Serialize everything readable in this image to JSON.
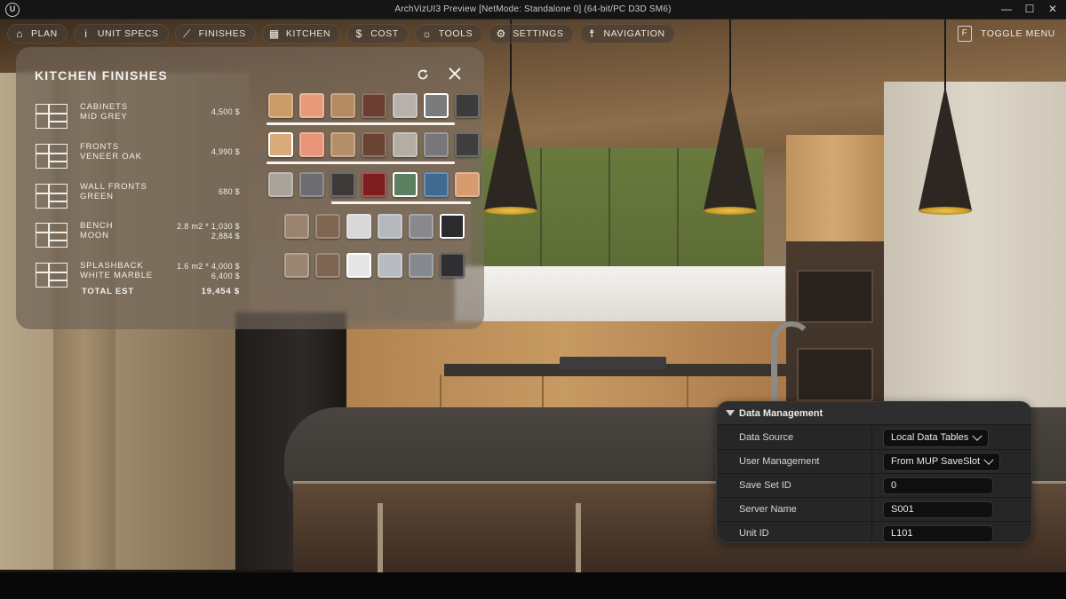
{
  "window": {
    "title": "ArchVizUI3 Preview [NetMode: Standalone 0]  (64-bit/PC D3D SM6)",
    "logo_glyph": "U",
    "controls": {
      "minimize": "—",
      "maximize": "☐",
      "close": "✕"
    }
  },
  "toolbar": {
    "items": [
      {
        "label": "PLAN",
        "icon": "home-icon"
      },
      {
        "label": "UNIT SPECS",
        "icon": "info-icon"
      },
      {
        "label": "FINISHES",
        "icon": "paint-roller-icon"
      },
      {
        "label": "KITCHEN",
        "icon": "kitchen-icon"
      },
      {
        "label": "COST",
        "icon": "dollar-icon"
      },
      {
        "label": "TOOLS",
        "icon": "sun-tools-icon"
      },
      {
        "label": "SETTINGS",
        "icon": "gear-icon"
      },
      {
        "label": "NAVIGATION",
        "icon": "person-icon"
      }
    ],
    "toggle_key": "F",
    "toggle_label": "TOGGLE MENU"
  },
  "finishes": {
    "title": "KITCHEN FINISHES",
    "rows": [
      {
        "name1": "CABINETS",
        "name2": "MID GREY",
        "qty": "",
        "price": "4,500 $"
      },
      {
        "name1": "FRONTS",
        "name2": "VENEER OAK",
        "qty": "",
        "price": "4,990 $"
      },
      {
        "name1": "WALL FRONTS",
        "name2": "GREEN",
        "qty": "",
        "price": "680 $"
      },
      {
        "name1": "BENCH",
        "name2": "MOON",
        "qty": "2.8 m2 * 1,030 $",
        "price": "2,884 $"
      },
      {
        "name1": "SPLASHBACK",
        "name2": "WHITE MARBLE",
        "qty": "1.6 m2 * 4,000 $",
        "price": "6,400 $"
      }
    ],
    "total_label": "TOTAL EST",
    "total_value": "19,454 $",
    "swatch_rows": [
      {
        "colors": [
          "#c99c6a",
          "#e79a7a",
          "#b48a63",
          "#6a3f32",
          "#b6b1aa",
          "#7b7b7d",
          "#3b3b3b"
        ],
        "selected": 5
      },
      {
        "colors": [
          "#d9ab7b",
          "#e8957a",
          "#b48e68",
          "#6b4335",
          "#b2ada5",
          "#77777a",
          "#3e3e3e"
        ],
        "selected": 0
      },
      {
        "colors": [
          "#a9a39c",
          "#6d6d70",
          "#3c3a38",
          "#7d1d20",
          "#5b7f60",
          "#3f6a92",
          "#d79b6f"
        ],
        "selected": 4
      },
      {
        "colors": [
          "#9a8470",
          "#7e6650",
          "#d8d8d8",
          "#b5b8bd",
          "#87898d",
          "#2b2b2d"
        ],
        "selected": 5
      },
      {
        "colors": [
          "#9b8672",
          "#7d6651",
          "#e6e6e6",
          "#b8bbc0",
          "#85888c",
          "#2f2f31"
        ],
        "selected": 2
      }
    ]
  },
  "data_management": {
    "title": "Data Management",
    "rows": [
      {
        "label": "Data Source",
        "value": "Local Data Tables",
        "kind": "combo"
      },
      {
        "label": "User Management",
        "value": "From MUP SaveSlot",
        "kind": "combo"
      },
      {
        "label": "Save Set ID",
        "value": "0",
        "kind": "field"
      },
      {
        "label": "Server Name",
        "value": "S001",
        "kind": "field"
      },
      {
        "label": "Unit ID",
        "value": "L101",
        "kind": "field"
      }
    ]
  }
}
